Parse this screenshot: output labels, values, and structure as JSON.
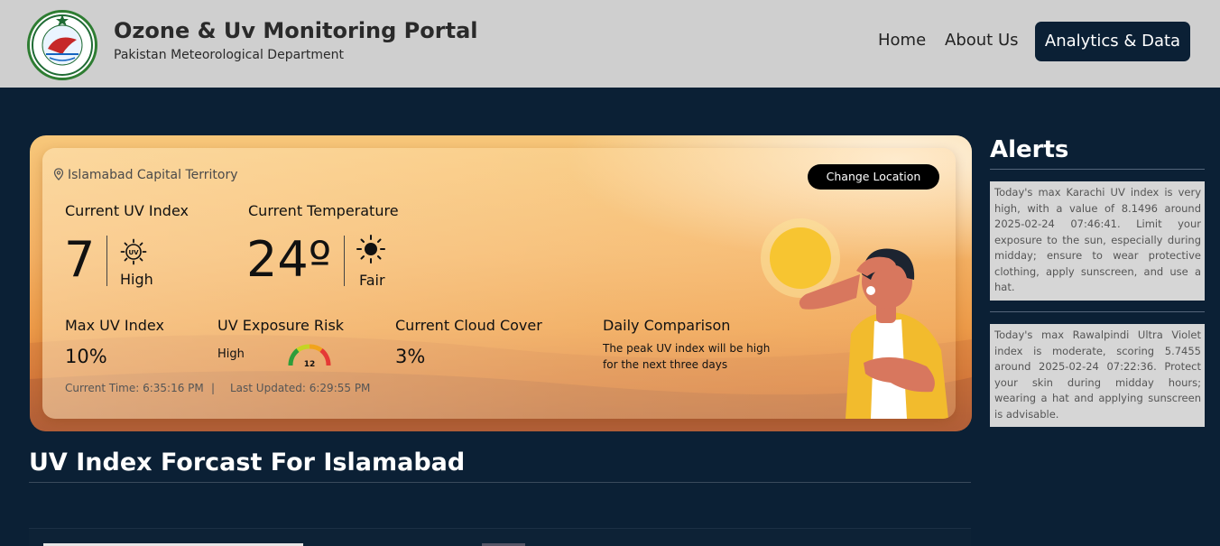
{
  "header": {
    "title": "Ozone & Uv Monitoring Portal",
    "subtitle": "Pakistan Meteorological Department",
    "nav": {
      "home": "Home",
      "about": "About Us",
      "analytics": "Analytics & Data"
    }
  },
  "logo": {
    "alt_text": "PAKISTAN METEOROLOGICAL DEPARTMENT"
  },
  "uv_card": {
    "location": "Islamabad Capital Territory",
    "change_location_label": "Change Location",
    "current_uv_label": "Current UV Index",
    "current_uv_value": "7",
    "uv_badge": "UV",
    "uv_level": "High",
    "current_temp_label": "Current Temperature",
    "current_temp_value": "24º",
    "condition": "Fair",
    "max_uv_label": "Max UV Index",
    "max_uv_value": "10%",
    "exposure_label": "UV Exposure Risk",
    "exposure_level": "High",
    "exposure_gauge_value": "12",
    "cloud_label": "Current Cloud Cover",
    "cloud_value": "3%",
    "comparison_label": "Daily Comparison",
    "comparison_text_1": "The peak UV index will be high",
    "comparison_text_2": "for the next three days",
    "current_time": "Current Time: 6:35:16 PM",
    "separator": "|",
    "last_updated": "Last Updated: 6:29:55 PM"
  },
  "forecast": {
    "title": "UV Index Forcast For Islamabad"
  },
  "alerts": {
    "title": "Alerts",
    "items": [
      "Today's max Karachi UV index is very high, with a value of 8.1496 around 2025-02-24 07:46:41. Limit your exposure to the sun, especially during midday; ensure to wear protective clothing, apply sunscreen, and use a hat.",
      "Today's max Rawalpindi Ultra Violet index is moderate, scoring 5.7455 around 2025-02-24 07:22:36. Protect your skin during midday hours; wearing a hat and applying sunscreen is advisable."
    ]
  },
  "colors": {
    "header_bg": "#cfcfcf",
    "page_bg": "#0b2035",
    "accent_button": "#0b2035",
    "alert_bg": "#d6d6d6"
  },
  "icons": [
    "location-pin-icon",
    "uv-sun-icon",
    "sun-icon",
    "uv-gauge-icon"
  ]
}
